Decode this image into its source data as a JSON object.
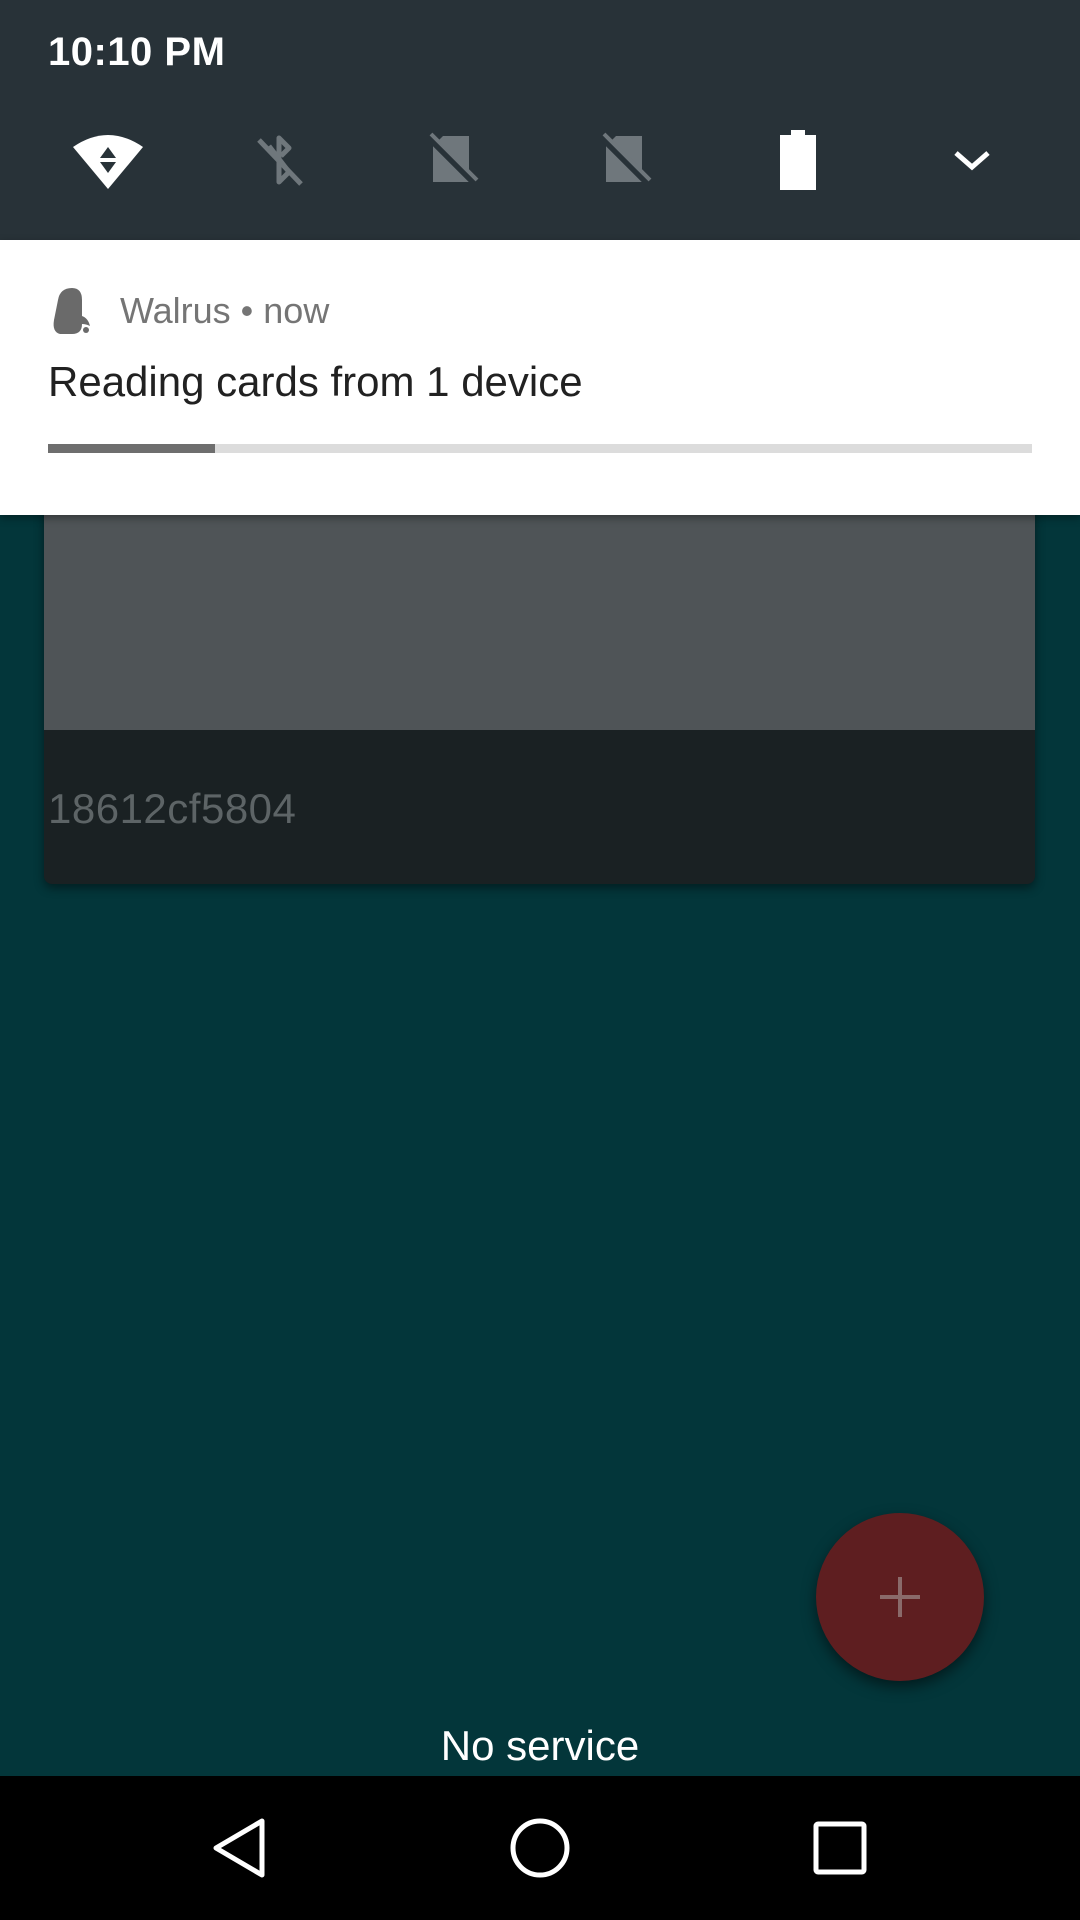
{
  "status_bar": {
    "time": "10:10 PM"
  },
  "quick_settings": {
    "tiles": [
      {
        "icon": "wifi-icon",
        "active": true
      },
      {
        "icon": "bluetooth-disabled-icon",
        "active": false
      },
      {
        "icon": "no-sim-icon",
        "active": false
      },
      {
        "icon": "no-sim-icon",
        "active": false
      },
      {
        "icon": "battery-icon",
        "active": true
      }
    ],
    "expand_icon": "chevron-down-icon"
  },
  "notification": {
    "app_name": "Walrus",
    "separator": "•",
    "time": "now",
    "title": "Reading cards from 1 device",
    "progress": 0.17,
    "icon": "walrus-app-icon"
  },
  "app": {
    "card_title": "18612cf5804",
    "fab_icon": "plus-icon",
    "status_text": "No service"
  },
  "nav": {
    "back_icon": "back-icon",
    "home_icon": "home-icon",
    "recents_icon": "recents-icon"
  },
  "colors": {
    "app_background": "#03363a",
    "shade_header": "#283238",
    "fab": "#5e1e20",
    "card_image": "#4f5457",
    "card_body": "#1a2123"
  }
}
